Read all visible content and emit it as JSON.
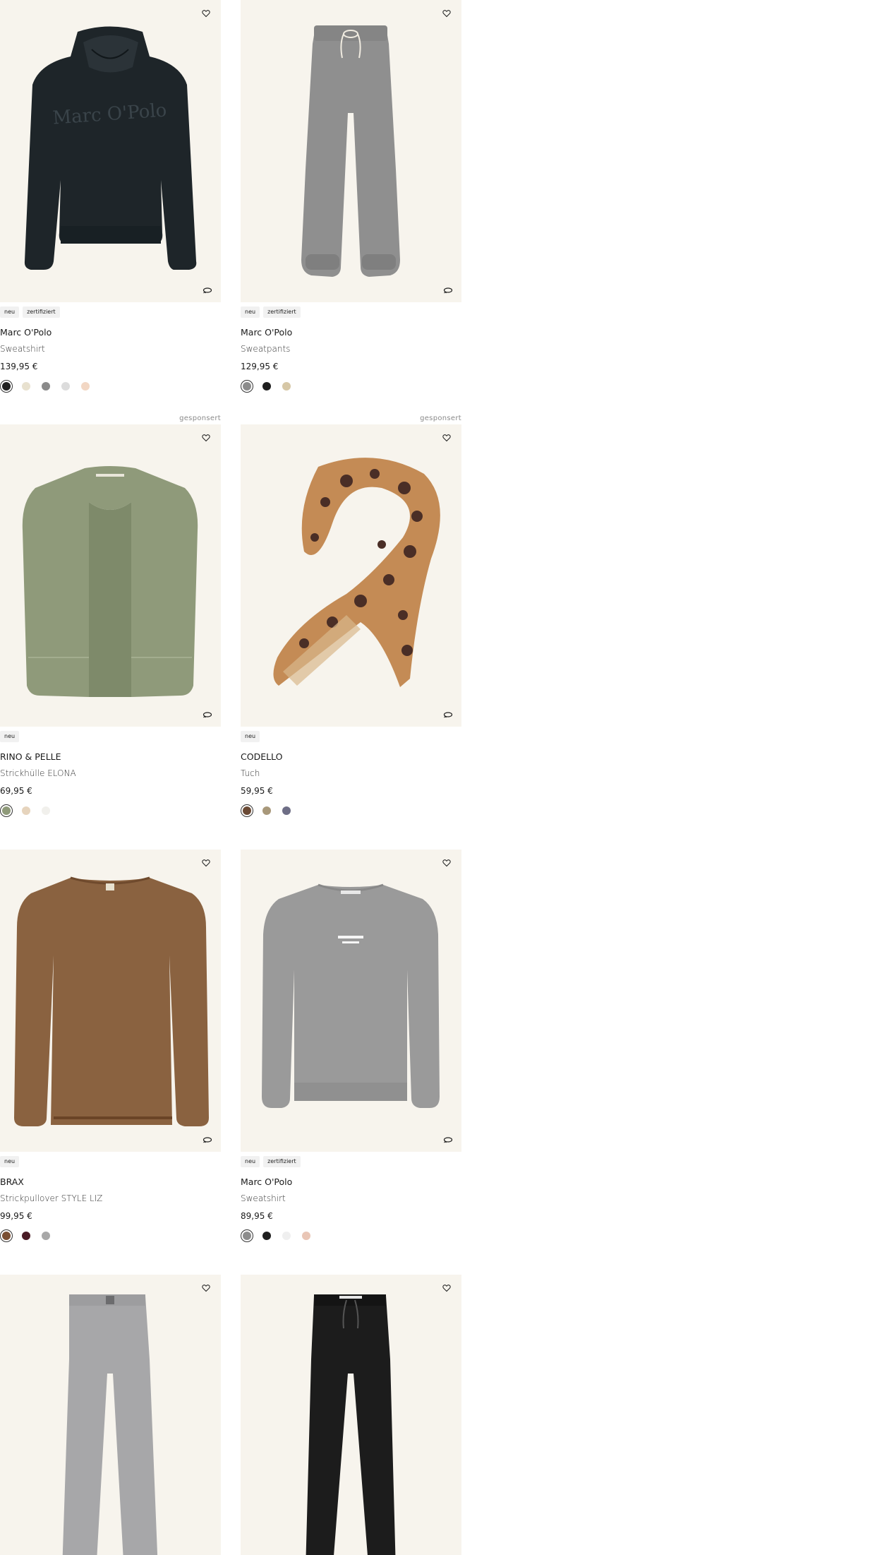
{
  "sponsored_label": "gesponsert",
  "products": [
    {
      "brand": "Marc O'Polo",
      "name": "Sweatshirt",
      "price": "139,95 €",
      "badges": [
        "neu",
        "zertifiziert"
      ],
      "sponsored": false,
      "image": "black-hoodie",
      "logo_text": "Marc O'Polo",
      "swatches": [
        "#1f1f1f",
        "#e8e1cf",
        "#8a8a8a",
        "#dcdcdc",
        "#f2d7c4"
      ]
    },
    {
      "brand": "Marc O'Polo",
      "name": "Sweatpants",
      "price": "129,95 €",
      "badges": [
        "neu",
        "zertifiziert"
      ],
      "sponsored": false,
      "image": "grey-sweatpants",
      "swatches": [
        "#8c8c8c",
        "#1f1f1f",
        "#d6c7a6"
      ]
    },
    {
      "brand": "RINO & PELLE",
      "name": "Strickhülle ELONA",
      "price": "69,95 €",
      "badges": [
        "neu"
      ],
      "sponsored": true,
      "image": "green-vest",
      "swatches": [
        "#8f9a7a",
        "#e6d4bd",
        "#f1f0ec"
      ]
    },
    {
      "brand": "CODELLO",
      "name": "Tuch",
      "price": "59,95 €",
      "badges": [
        "neu"
      ],
      "sponsored": true,
      "image": "leopard-scarf",
      "swatches": [
        "#6b4a35",
        "#a8987a",
        "#6e6e86"
      ]
    },
    {
      "brand": "BRAX",
      "name": "Strickpullover STYLE LIZ",
      "price": "99,95 €",
      "badges": [
        "neu"
      ],
      "sponsored": false,
      "image": "brown-sweater",
      "swatches": [
        "#7a4f33",
        "#4a1c26",
        "#a8a8a8"
      ]
    },
    {
      "brand": "Marc O'Polo",
      "name": "Sweatshirt",
      "price": "89,95 €",
      "badges": [
        "neu",
        "zertifiziert"
      ],
      "sponsored": false,
      "image": "grey-sweatshirt",
      "swatches": [
        "#8c8c8c",
        "#1f1f1f",
        "#efefef",
        "#e9c6b6"
      ]
    },
    {
      "image": "grey-trousers"
    },
    {
      "image": "black-trousers"
    }
  ]
}
